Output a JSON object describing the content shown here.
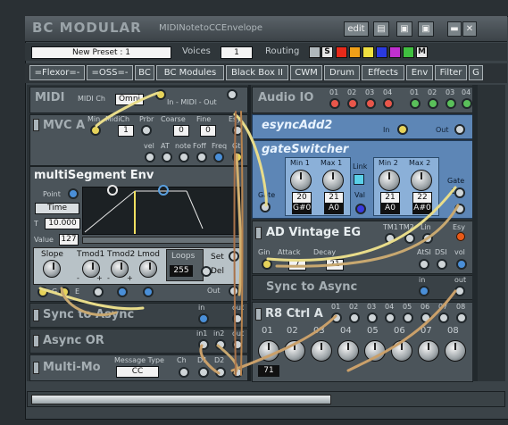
{
  "window": {
    "title": "BC MODULAR",
    "subtitle": "MIDINotetoCCEnvelope",
    "edit_label": "edit"
  },
  "toolbar": {
    "preset": "New Preset : 1",
    "voices_label": "Voices",
    "voices_value": "1",
    "routing_label": "Routing",
    "s_label": "S",
    "m_label": "M",
    "swatches": [
      "#b0b8bc",
      "#e82a1a",
      "#f0a018",
      "#f0e040",
      "#2a3ae0",
      "#c030d0",
      "#40c040"
    ]
  },
  "nav": [
    "=Flexor=-",
    "=OSS=-",
    "BC",
    "BC Modules",
    "Black Box II",
    "CWM",
    "Drum",
    "Effects",
    "Env",
    "Filter",
    "G"
  ],
  "midi": {
    "title": "MIDI",
    "ch_label": "MIDI Ch",
    "ch_value": "Omni",
    "io_label": "In - MIDI - Out"
  },
  "audio_io": {
    "title": "Audio IO",
    "ports": [
      "01",
      "02",
      "03",
      "04",
      "01",
      "02",
      "03",
      "04"
    ],
    "in_label": "In",
    "out_label": "Out"
  },
  "mvca": {
    "title": "MVC A",
    "labels": [
      "Min",
      "MidiCh",
      "Prbr",
      "Coarse",
      "Fine",
      "Esy"
    ],
    "values": [
      "1",
      "0",
      "0"
    ],
    "jack_labels": [
      "vel",
      "AT",
      "note",
      "Foff",
      "Freq",
      "Gt"
    ]
  },
  "esync": {
    "title": "esyncAdd2"
  },
  "gate": {
    "title": "gateSwitcher",
    "min1": "Min 1",
    "max1": "Max 1",
    "link": "Link",
    "min2": "Min 2",
    "max2": "Max 2",
    "gate_l": "Gate",
    "gate_r": "Gate",
    "v1": "20",
    "v2": "21",
    "v3": "21",
    "v4": "22",
    "n1": "G#0",
    "n2": "A0",
    "n3": "A0",
    "n4": "A#0",
    "val": "Val",
    "one": "1"
  },
  "mseg": {
    "title": "multiSegment Env",
    "point_label": "Point",
    "time_label": "Time",
    "t_label": "T",
    "t_value": "10.000",
    "value_label": "Value",
    "value_value": "127",
    "slope": "Slope",
    "tmod1": "Tmod1",
    "tmod2": "Tmod2",
    "lmod": "Lmod",
    "loops": "Loops",
    "loops_val": "255",
    "set": "Set",
    "del": "Del",
    "out": "Out",
    "g": "G",
    "e": "E",
    "minus": "-",
    "plus": "+"
  },
  "ad": {
    "title": "AD Vintage EG",
    "tm1": "TM1",
    "tm2": "TM2",
    "lin": "Lin",
    "esy": "Esy",
    "gin": "Gin",
    "attack": "Attack",
    "decay": "Decay",
    "atk_val": "7",
    "dec_val": "21",
    "atsi": "AtSI",
    "dsi": "DSI",
    "vol": "vol"
  },
  "sync1": {
    "title": "Sync to Async",
    "in": "in",
    "out": "out"
  },
  "sync2": {
    "title": "Sync to Async",
    "in": "in",
    "out": "out"
  },
  "async_or": {
    "title": "Async OR",
    "in1": "in1",
    "in2": "in2",
    "out": "out"
  },
  "r8": {
    "title": "R8 Ctrl A",
    "ports": [
      "01",
      "02",
      "03",
      "04",
      "05",
      "06",
      "07",
      "08"
    ],
    "knob_labels": [
      "01",
      "02",
      "03",
      "04",
      "05",
      "06",
      "07",
      "08"
    ],
    "first_val": "71"
  },
  "multimo": {
    "title": "Multi-Mo",
    "msg_label": "Message Type",
    "msg_value": "CC",
    "ch": "Ch",
    "d1": "D1",
    "d2": "D2"
  }
}
